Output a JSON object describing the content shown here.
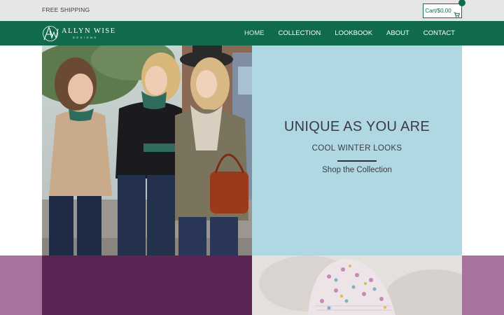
{
  "topbar": {
    "promo": "FREE SHIPPING",
    "cart_label": "Cart/$0.00",
    "cart_icon": "cart-icon"
  },
  "brand": {
    "name": "ALLYN WISE",
    "sub": "DESIGNS",
    "monogram": "AW",
    "color_primary": "#0f6b4c"
  },
  "nav": {
    "items": [
      {
        "label": "HOME"
      },
      {
        "label": "COLLECTION"
      },
      {
        "label": "LOOKBOOK"
      },
      {
        "label": "ABOUT"
      },
      {
        "label": "CONTACT"
      }
    ]
  },
  "hero": {
    "headline": "UNIQUE AS YOU ARE",
    "subhead": "COOL WINTER LOOKS",
    "cta": "Shop the Collection",
    "panel_color": "#b0d8e3"
  },
  "promo": {
    "dark_color": "#5b2453",
    "side_color": "#a8729f"
  }
}
